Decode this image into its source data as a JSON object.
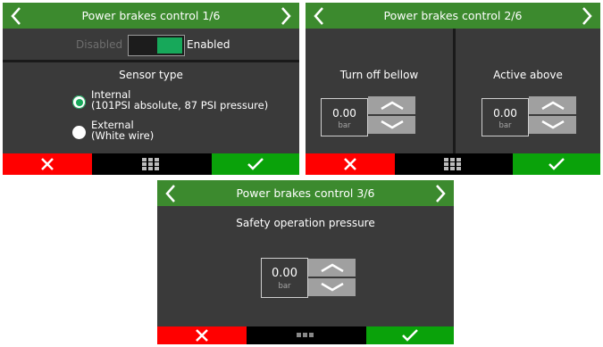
{
  "panels": [
    {
      "title": "Power brakes control 1/6",
      "toggle": {
        "off_label": "Disabled",
        "on_label": "Enabled",
        "state": "on"
      },
      "sensor_type_label": "Sensor type",
      "options": [
        {
          "line1": "Internal",
          "line2": "(101PSI absolute, 87 PSI pressure)",
          "selected": true
        },
        {
          "line1": "External",
          "line2": "(White wire)",
          "selected": false
        }
      ]
    },
    {
      "title": "Power brakes control 2/6",
      "left": {
        "label": "Turn off bellow",
        "value": "0.00",
        "unit": "bar"
      },
      "right": {
        "label": "Active above",
        "value": "0.00",
        "unit": "bar"
      }
    },
    {
      "title": "Power brakes control 3/6",
      "label": "Safety operation pressure",
      "value": "0.00",
      "unit": "bar"
    }
  ],
  "icons": {
    "prev": "chevron-left-icon",
    "next": "chevron-right-icon",
    "cancel": "close-icon",
    "menu": "grid-icon",
    "confirm": "check-icon"
  },
  "colors": {
    "header": "#3c8a2e",
    "panel_bg": "#3a3a3a",
    "cancel": "#ff0000",
    "confirm": "#0aa20a",
    "accent": "#17a85a"
  }
}
